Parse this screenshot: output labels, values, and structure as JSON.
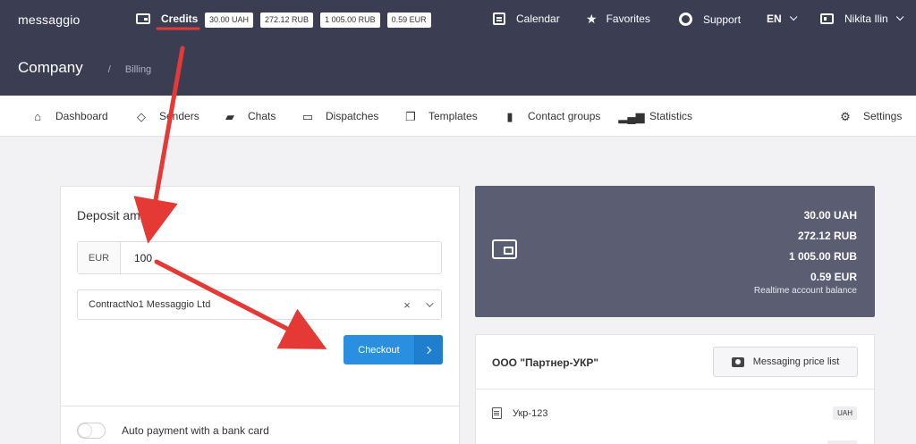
{
  "header": {
    "logo": "messaggio",
    "credits_label": "Credits",
    "balances": [
      "30.00 UAH",
      "272.12 RUB",
      "1 005.00 RUB",
      "0.59 EUR"
    ],
    "calendar": "Calendar",
    "favorites": "Favorites",
    "support": "Support",
    "language": "EN",
    "user": "Nikita Ilin",
    "page_title": "Company",
    "breadcrumb_sep": "/",
    "breadcrumb": "Billing"
  },
  "nav": {
    "dashboard": "Dashboard",
    "senders": "Senders",
    "chats": "Chats",
    "dispatches": "Dispatches",
    "templates": "Templates",
    "contact_groups": "Contact groups",
    "statistics": "Statistics",
    "settings": "Settings"
  },
  "deposit": {
    "title": "Deposit amount",
    "currency": "EUR",
    "amount": "100",
    "contract": "ContractNo1 Messaggio Ltd",
    "clear_symbol": "×",
    "checkout_label": "Checkout",
    "auto_payment_label": "Auto payment with a bank card"
  },
  "balance_card": {
    "lines": [
      "30.00 UAH",
      "272.12 RUB",
      "1 005.00 RUB",
      "0.59 EUR"
    ],
    "note": "Realtime account balance"
  },
  "partner": {
    "name": "ООО \"Партнер-УКР\"",
    "price_list_label": "Messaging price list",
    "rows": [
      {
        "name": "Укр-123",
        "currency": "UAH"
      }
    ]
  },
  "colors": {
    "header_bg": "#3b3e53",
    "balance_bg": "#5b5e72",
    "accent_blue": "#2a8fe0",
    "annotation_red": "#e53935"
  }
}
